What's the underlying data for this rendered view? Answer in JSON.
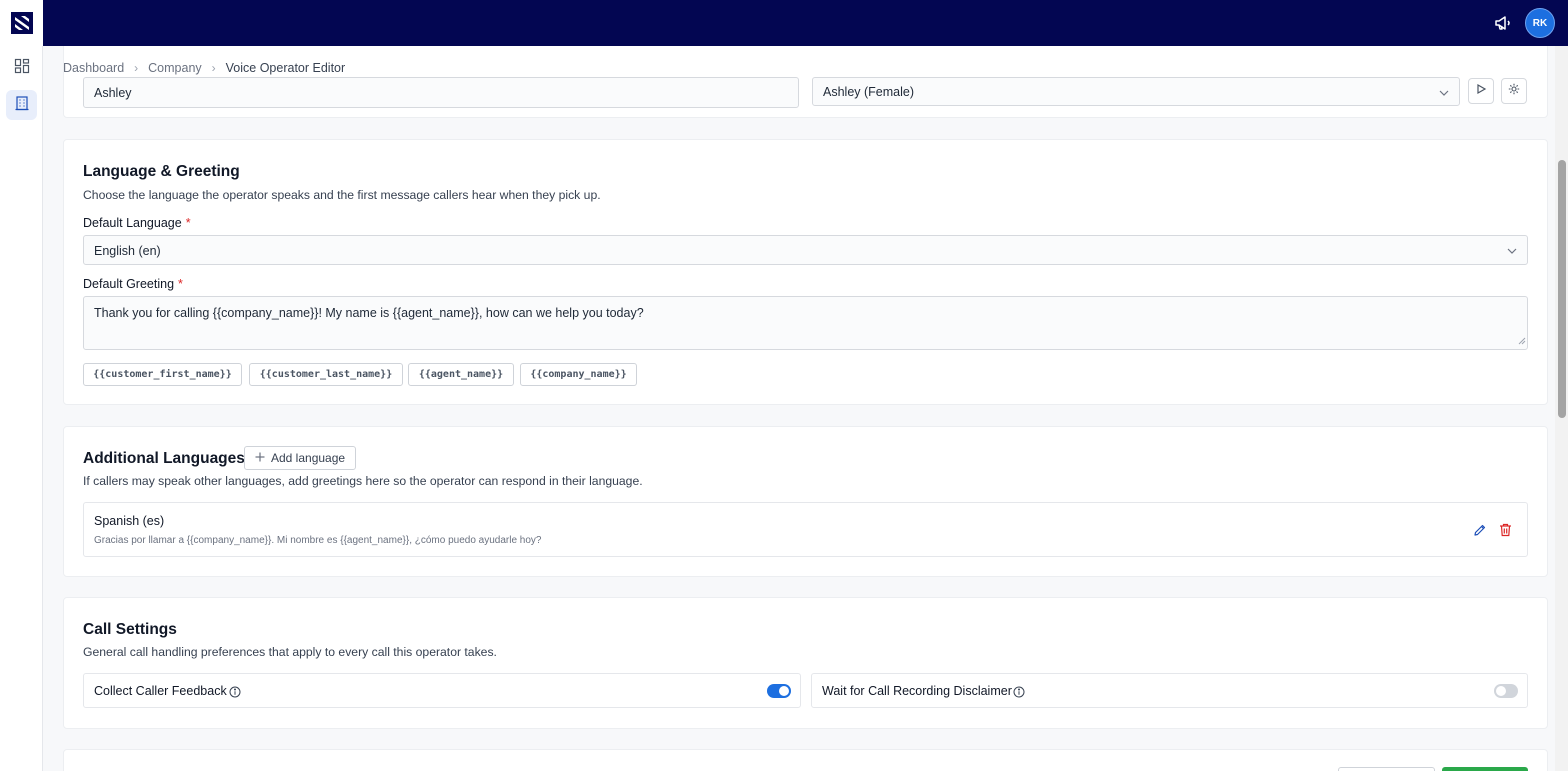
{
  "app": {
    "brand_icon": "brand-logo",
    "user_initials": "RK"
  },
  "header": {
    "announcements_icon": "megaphone-icon"
  },
  "sidebar": {
    "items": [
      {
        "icon": "dashboard-grid-icon",
        "active": false
      },
      {
        "icon": "company-building-icon",
        "active": true
      }
    ]
  },
  "breadcrumb": {
    "items": [
      "Dashboard",
      "Company"
    ],
    "current": "Voice Operator Editor"
  },
  "identity": {
    "name_value": "Ashley",
    "voice_value": "Ashley (Female)"
  },
  "language_greeting": {
    "title": "Language & Greeting",
    "description": "Choose the language the operator speaks and the first message callers hear when they pick up.",
    "default_language_label": "Default Language",
    "default_language_value": "English (en)",
    "default_greeting_label": "Default Greeting",
    "default_greeting_value": "Thank you for calling {{company_name}}! My name is {{agent_name}}, how can we help you today?",
    "variables": [
      "{{customer_first_name}}",
      "{{customer_last_name}}",
      "{{agent_name}}",
      "{{company_name}}"
    ],
    "required_mark": "*"
  },
  "additional_languages": {
    "title": "Additional Languages",
    "add_button_label": "Add language",
    "description": "If callers may speak other languages, add greetings here so the operator can respond in their language.",
    "items": [
      {
        "language": "Spanish (es)",
        "greeting": "Gracias por llamar a {{company_name}}. Mi nombre es {{agent_name}}, ¿cómo puedo ayudarle hoy?"
      }
    ]
  },
  "call_settings": {
    "title": "Call Settings",
    "description": "General call handling preferences that apply to every call this operator takes.",
    "toggles": [
      {
        "label": "Collect Caller Feedback",
        "enabled": true
      },
      {
        "label": "Wait for Call Recording Disclaimer",
        "enabled": false
      }
    ]
  },
  "colors": {
    "topbar": "#030652",
    "accent": "#1d6fe0",
    "danger": "#dc2626",
    "save_green": "#2aa84a"
  }
}
